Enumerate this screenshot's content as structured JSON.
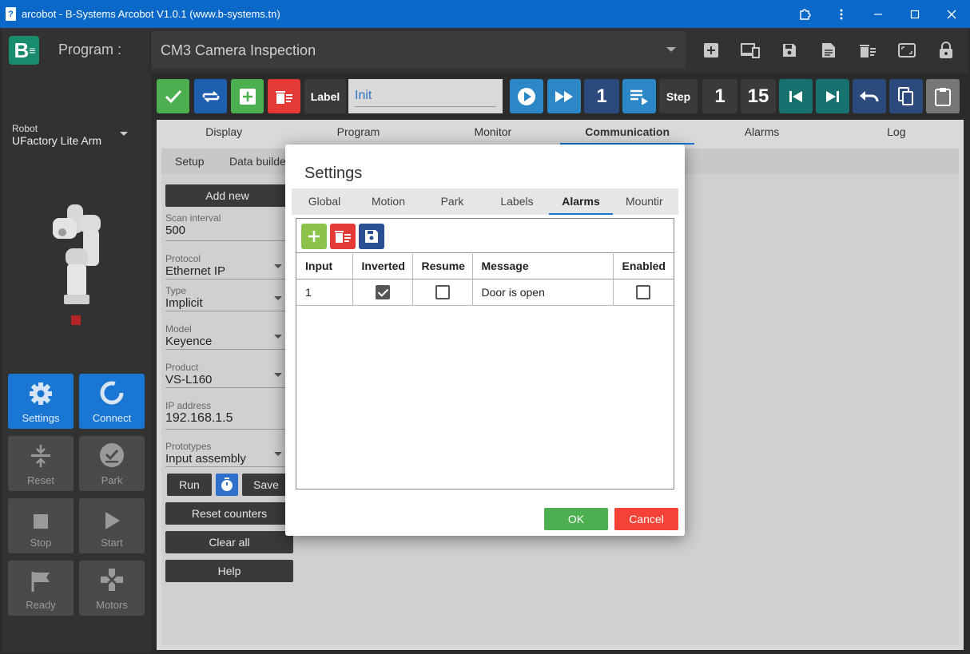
{
  "window": {
    "title": "arcobot - B-Systems Arcobot V1.0.1 (www.b-systems.tn)",
    "controls": [
      "extension-icon",
      "more-icon",
      "minimize-icon",
      "maximize-icon",
      "close-icon"
    ]
  },
  "header": {
    "logo_text": "B",
    "program_label": "Program :",
    "program_value": "CM3 Camera Inspection",
    "icons": [
      "add-box-icon",
      "devices-icon",
      "save-icon",
      "document-icon",
      "delete-list-icon",
      "screen-icon",
      "lock-icon"
    ]
  },
  "sidebar": {
    "robot_caption": "Robot",
    "robot_name": "UFactory Lite Arm",
    "buttons": [
      {
        "label": "Settings",
        "icon": "gear-icon",
        "active": true
      },
      {
        "label": "Connect",
        "icon": "connect-icon",
        "active": true
      },
      {
        "label": "Reset",
        "icon": "reset-icon",
        "active": false
      },
      {
        "label": "Park",
        "icon": "park-icon",
        "active": false
      },
      {
        "label": "Stop",
        "icon": "stop-icon",
        "active": false
      },
      {
        "label": "Start",
        "icon": "play-icon",
        "active": false
      },
      {
        "label": "Ready",
        "icon": "flag-icon",
        "active": false
      },
      {
        "label": "Motors",
        "icon": "motors-icon",
        "active": false
      }
    ]
  },
  "toolbar": {
    "label_button": "Label",
    "label_input_value": "Init",
    "speed_value": "1",
    "step_label": "Step",
    "step_value": "1",
    "step_total": "15"
  },
  "main_tabs": [
    "Display",
    "Program",
    "Monitor",
    "Communication",
    "Alarms",
    "Log"
  ],
  "main_tab_active": "Communication",
  "sub_tabs": [
    "Setup",
    "Data builde"
  ],
  "panel": {
    "add_new": "Add new",
    "scan_interval_label": "Scan interval",
    "scan_interval_value": "500",
    "protocol_label": "Protocol",
    "protocol_value": "Ethernet IP",
    "type_label": "Type",
    "type_value": "Implicit",
    "model_label": "Model",
    "model_value": "Keyence",
    "product_label": "Product",
    "product_value": "VS-L160",
    "ip_label": "IP address",
    "ip_value": "192.168.1.5",
    "prototypes_label": "Prototypes",
    "prototypes_value": "Input assembly",
    "run": "Run",
    "save": "Save",
    "reset_counters": "Reset counters",
    "clear_all": "Clear all",
    "help": "Help"
  },
  "modal": {
    "title": "Settings",
    "tabs": [
      "Global",
      "Motion",
      "Park",
      "Labels",
      "Alarms",
      "Mountir"
    ],
    "active_tab": "Alarms",
    "columns": [
      "Input",
      "Inverted",
      "Resume",
      "Message",
      "Enabled"
    ],
    "rows": [
      {
        "input": "1",
        "inverted": true,
        "resume": false,
        "message": "Door is open",
        "enabled": false
      }
    ],
    "ok": "OK",
    "cancel": "Cancel"
  },
  "colors": {
    "titlebar": "#0a68c9",
    "accent": "#1976d2",
    "green": "#4caf50",
    "red": "#f44336"
  }
}
